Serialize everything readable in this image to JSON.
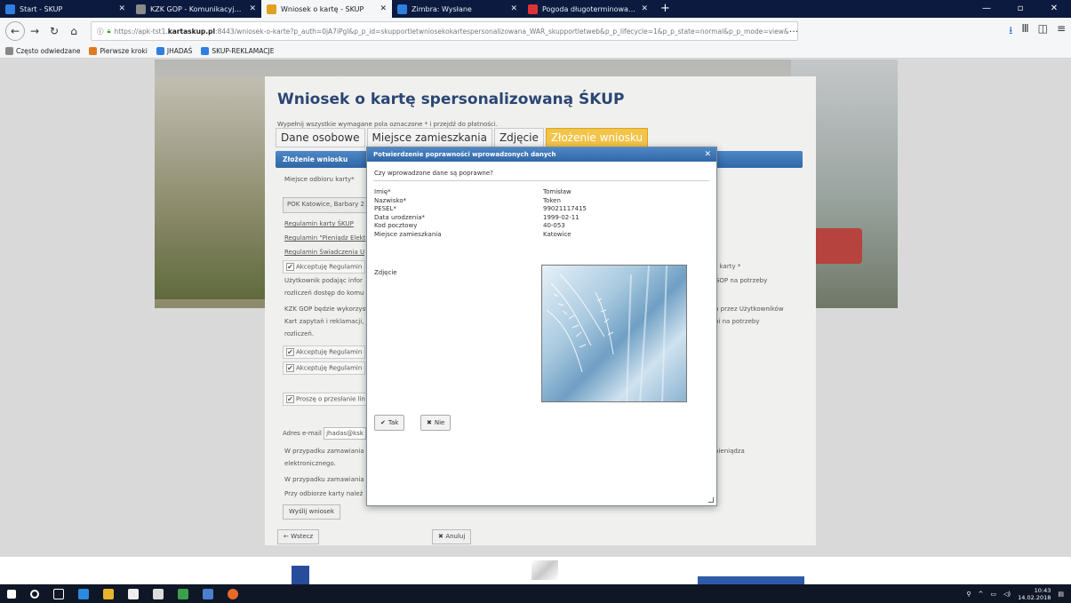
{
  "browser": {
    "tabs": [
      {
        "label": "Start - ŚKUP",
        "color": "#2f7fe0",
        "active": false
      },
      {
        "label": "KZK GOP - Komunikacyjny Zw",
        "color": "#8a8a8a",
        "active": false
      },
      {
        "label": "Wniosek o kartę - ŚKUP",
        "color": "#e0a020",
        "active": true
      },
      {
        "label": "Zimbra: Wysłane",
        "color": "#2f7fe0",
        "active": false
      },
      {
        "label": "Pogoda długoterminowa - by",
        "color": "#d33",
        "active": false
      }
    ],
    "url_prefix": "https://apk-tst1.",
    "url_domain": "kartaskup.pl",
    "url_rest": ":8443/wniosek-o-karte?p_auth=0jA7iPgl&p_p_id=skupportletwniosekokartespersonalizowana_WAR_skupportletweb&p_p_lifecycle=1&p_p_state=normal&p_p_mode=view&",
    "bookmarks": [
      {
        "label": "Często odwiedzane",
        "color": "#888"
      },
      {
        "label": "Pierwsze kroki",
        "color": "#e07a20"
      },
      {
        "label": "JHADAŚ",
        "color": "#2f7fe0"
      },
      {
        "label": "SKUP-REKLAMACJE",
        "color": "#2f7fe0"
      }
    ]
  },
  "form": {
    "title": "Wniosek o kartę spersonalizowaną ŚKUP",
    "hint": "Wypełnij wszystkie wymagane pola oznaczone * i przejdź do płatności.",
    "steps": [
      "Dane osobowe",
      "Miejsce zamieszkania",
      "Zdjęcie",
      "Złożenie wniosku"
    ],
    "section": "Złożenie wniosku",
    "pickup_label": "Miejsce odbioru karty*",
    "pickup_value": "POK Katowice, Barbary 2",
    "links": [
      "Regulamin karty ŚKUP",
      "Regulamin \"Pieniądz Elekt",
      "Regulamin Świadczenia U"
    ],
    "accept1": "Akceptuję Regulamin",
    "right_accept": "gi karty *",
    "para1_a": "Użytkownik podając infor",
    "para1_b": "rozliczeń dostęp do komu",
    "right_para1": "GOP na potrzeby",
    "para2_a": "KZK GOP będzie wykorzyst",
    "para2_b": "Kart zapytań i reklamacji, j",
    "para2_c": "rozliczeń.",
    "right_para2_a": "n przez Użytkowników",
    "right_para2_b": "ni na potrzeby",
    "accept2": "Akceptuję Regulamin",
    "accept3": "Akceptuję Regulamin",
    "request_send": "Proszę o przesłanie lin",
    "email_label": "Adres e-mail",
    "email_value": "jhadas@ksk",
    "para3_a": "W przypadku zamawiania",
    "para3_b": "elektronicznego.",
    "right_para3": "pieniądza",
    "para4": "W przypadku zamawiania",
    "para5": "Przy odbiorze karty należ",
    "submit": "Wyślij wniosek",
    "back": "← Wstecz",
    "cancel": "Anuluj"
  },
  "dialog": {
    "title": "Potwierdzenie poprawności wprowadzonych danych",
    "question": "Czy wprowadzone dane są poprawne?",
    "rows": [
      {
        "label": "Imię*",
        "value": "Tomisław"
      },
      {
        "label": "Nazwisko*",
        "value": "Token"
      },
      {
        "label": "PESEL*",
        "value": "99021117415"
      },
      {
        "label": "Data urodzenia*",
        "value": "1999-02-11"
      },
      {
        "label": "Kod pocztowy",
        "value": "40-053"
      },
      {
        "label": "Miejsce zamieszkania",
        "value": "Katowice"
      }
    ],
    "photo_label": "Zdjęcie",
    "yes": "Tak",
    "no": "Nie"
  },
  "taskbar": {
    "time": "10:43",
    "date": "14.02.2018"
  }
}
